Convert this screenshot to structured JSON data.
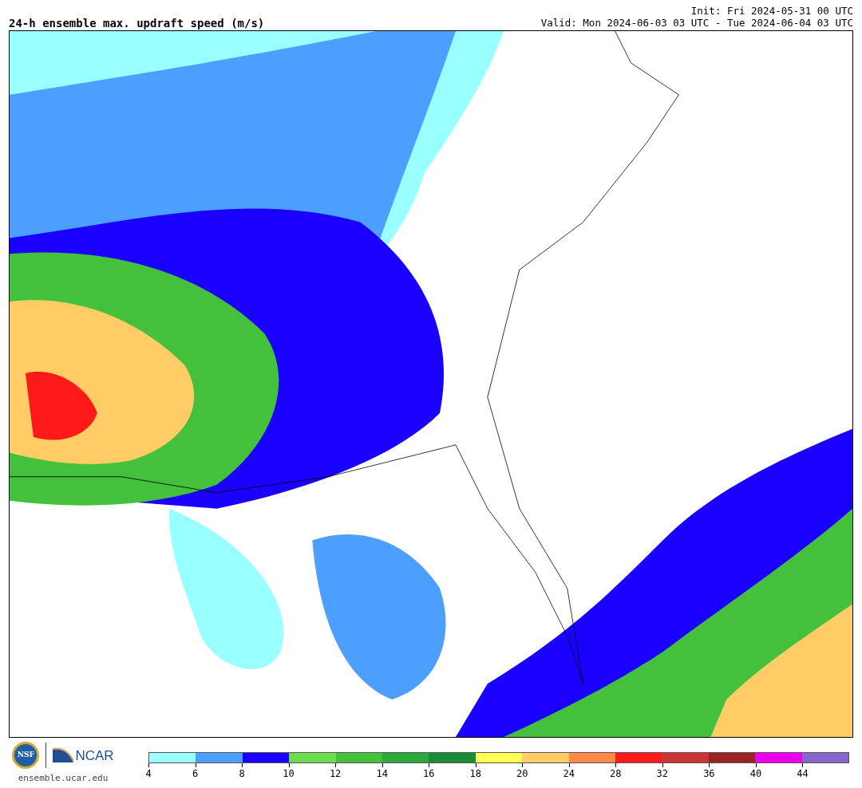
{
  "title": "24-h ensemble max. updraft speed (m/s)",
  "init": "Init: Fri 2024-05-31 00 UTC",
  "valid": "Valid: Mon 2024-06-03 03 UTC - Tue 2024-06-04 03 UTC",
  "logos": {
    "nsf": "NSF",
    "ncar": "NCAR",
    "url": "ensemble.ucar.edu"
  },
  "colorbar": [
    {
      "label": "4",
      "color": "#99ffff"
    },
    {
      "label": "6",
      "color": "#4d9fff"
    },
    {
      "label": "8",
      "color": "#1a00ff"
    },
    {
      "label": "10",
      "color": "#6cdc4c"
    },
    {
      "label": "12",
      "color": "#44c03c"
    },
    {
      "label": "14",
      "color": "#2aa83a"
    },
    {
      "label": "16",
      "color": "#1a8c38"
    },
    {
      "label": "18",
      "color": "#ffff55"
    },
    {
      "label": "20",
      "color": "#ffcc66"
    },
    {
      "label": "24",
      "color": "#ff8844"
    },
    {
      "label": "28",
      "color": "#ff1a1a"
    },
    {
      "label": "32",
      "color": "#cc3333"
    },
    {
      "label": "36",
      "color": "#992222"
    },
    {
      "label": "40",
      "color": "#ee00ee"
    },
    {
      "label": "44",
      "color": "#8866cc"
    }
  ]
}
